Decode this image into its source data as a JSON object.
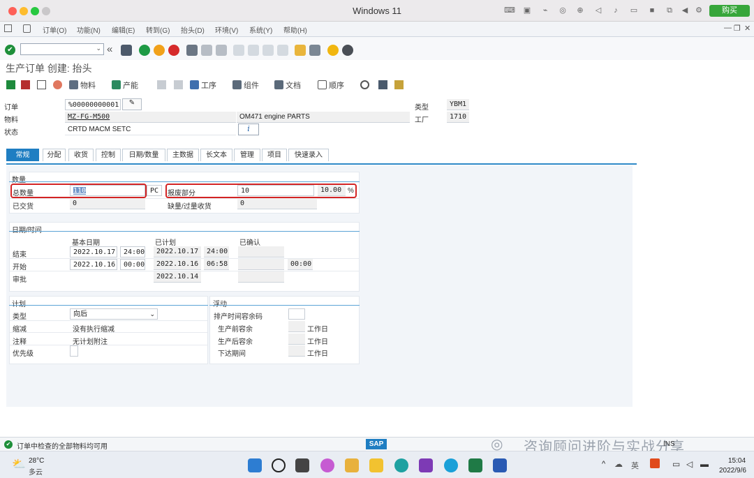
{
  "window": {
    "title": "Windows 11",
    "buy": "购买"
  },
  "menu": [
    "订单(O)",
    "功能(N)",
    "编辑(E)",
    "转到(G)",
    "抬头(D)",
    "环境(V)",
    "系统(Y)",
    "帮助(H)"
  ],
  "page_title": "生产订单 创建: 抬头",
  "apptb": {
    "material": "物料",
    "capacity": "产能",
    "operation": "工序",
    "component": "组件",
    "document": "文档",
    "sequence": "顺序"
  },
  "header": {
    "order_label": "订单",
    "order_value": "%00000000001",
    "material_label": "物料",
    "material_value": "MZ-FG-M500",
    "material_desc": "OM471 engine PARTS",
    "status_label": "状态",
    "status_value": "CRTD MACM SETC",
    "type_label": "类型",
    "type_value": "YBM1",
    "plant_label": "工厂",
    "plant_value": "1710"
  },
  "tabs": [
    "常规",
    "分配",
    "收货",
    "控制",
    "日期/数量",
    "主数据",
    "长文本",
    "管理",
    "项目",
    "快速录入"
  ],
  "qty": {
    "group": "数量",
    "total_label": "总数量",
    "total_value": "110",
    "unit": "PC",
    "scrap_label": "报废部分",
    "scrap_value": "10",
    "scrap_pct": "10.00",
    "pct": "%",
    "delivered_label": "已交货",
    "delivered_value": "0",
    "shortage_label": "缺量/过量收货",
    "shortage_value": "0"
  },
  "dates": {
    "group": "日期/时间",
    "col_basic": "基本日期",
    "col_sched": "已计划",
    "col_confirmed": "已确认",
    "end_label": "结束",
    "end_basic": "2022.10.17",
    "end_basic_time": "24:00",
    "end_sched": "2022.10.17",
    "end_sched_time": "24:00",
    "start_label": "开始",
    "start_basic": "2022.10.16",
    "start_basic_time": "00:00",
    "start_sched": "2022.10.16",
    "start_sched_time": "06:58",
    "start_conf_time": "00:00",
    "release_label": "审批",
    "release_sched": "2022.10.14"
  },
  "plan": {
    "group": "计划",
    "type_label": "类型",
    "type_value": "向后",
    "reduce_label": "缩减",
    "reduce_value": "没有执行缩减",
    "note_label": "注释",
    "note_value": "无计划附注",
    "priority_label": "优先级"
  },
  "float": {
    "group": "浮动",
    "sched_margin": "排产时间容余码",
    "before": "生产前容余",
    "after": "生产后容余",
    "release": "下达期间",
    "unit": "工作日"
  },
  "status": {
    "message": "订单中检查的全部物料均可用",
    "sap": "SAP",
    "watermark": "咨询顾问进阶与实战分享",
    "ins": "INS"
  },
  "taskbar": {
    "temp": "28°C",
    "weather": "多云",
    "time": "15:04",
    "date": "2022/9/6",
    "lang": "英"
  },
  "colors": {
    "sap_blue": "#1f7ec2",
    "highlight": "#d32424"
  }
}
